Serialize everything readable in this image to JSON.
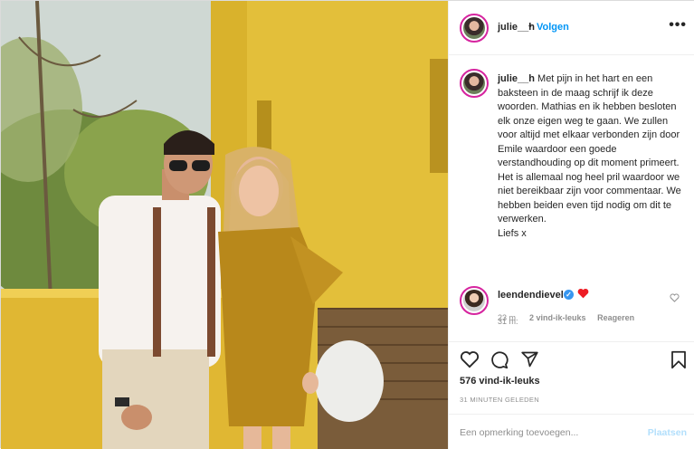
{
  "post": {
    "author": "julie__h",
    "separator": "•",
    "follow_label": "Volgen",
    "more_label": "•••",
    "caption_author": "julie__h",
    "caption_text": "Met pijn in het hart en een baksteen in de maag schrijf ik deze woorden. Mathias en ik hebben besloten elk onze eigen weg te gaan. We zullen voor altijd met elkaar verbonden zijn door Emile waardoor een goede verstandhouding op dit moment primeert. Het is allemaal nog heel pril waardoor we niet bereikbaar zijn voor commentaar. We hebben beiden even tijd nodig om dit te verwerken.\nLiefs x",
    "caption_time": "31 m."
  },
  "comment": {
    "user": "leendendievel",
    "verified_mark": "✓",
    "emoji": "heart",
    "time": "23 m.",
    "likes": "2 vind-ik-leuks",
    "reply": "Reageren"
  },
  "actions": {
    "icons": [
      "heart-icon",
      "comment-icon",
      "share-icon",
      "bookmark-icon"
    ],
    "likes_count": "576 vind-ik-leuks",
    "posted_ago": "31 MINUTEN GELEDEN"
  },
  "add_comment": {
    "placeholder": "Een opmerking toevoegen...",
    "post_label": "Plaatsen"
  },
  "colors": {
    "link_blue": "#0095f6",
    "muted_gray": "#8e8e8e",
    "heart_red": "#ed4956",
    "disabled_blue": "#b2dffc"
  }
}
